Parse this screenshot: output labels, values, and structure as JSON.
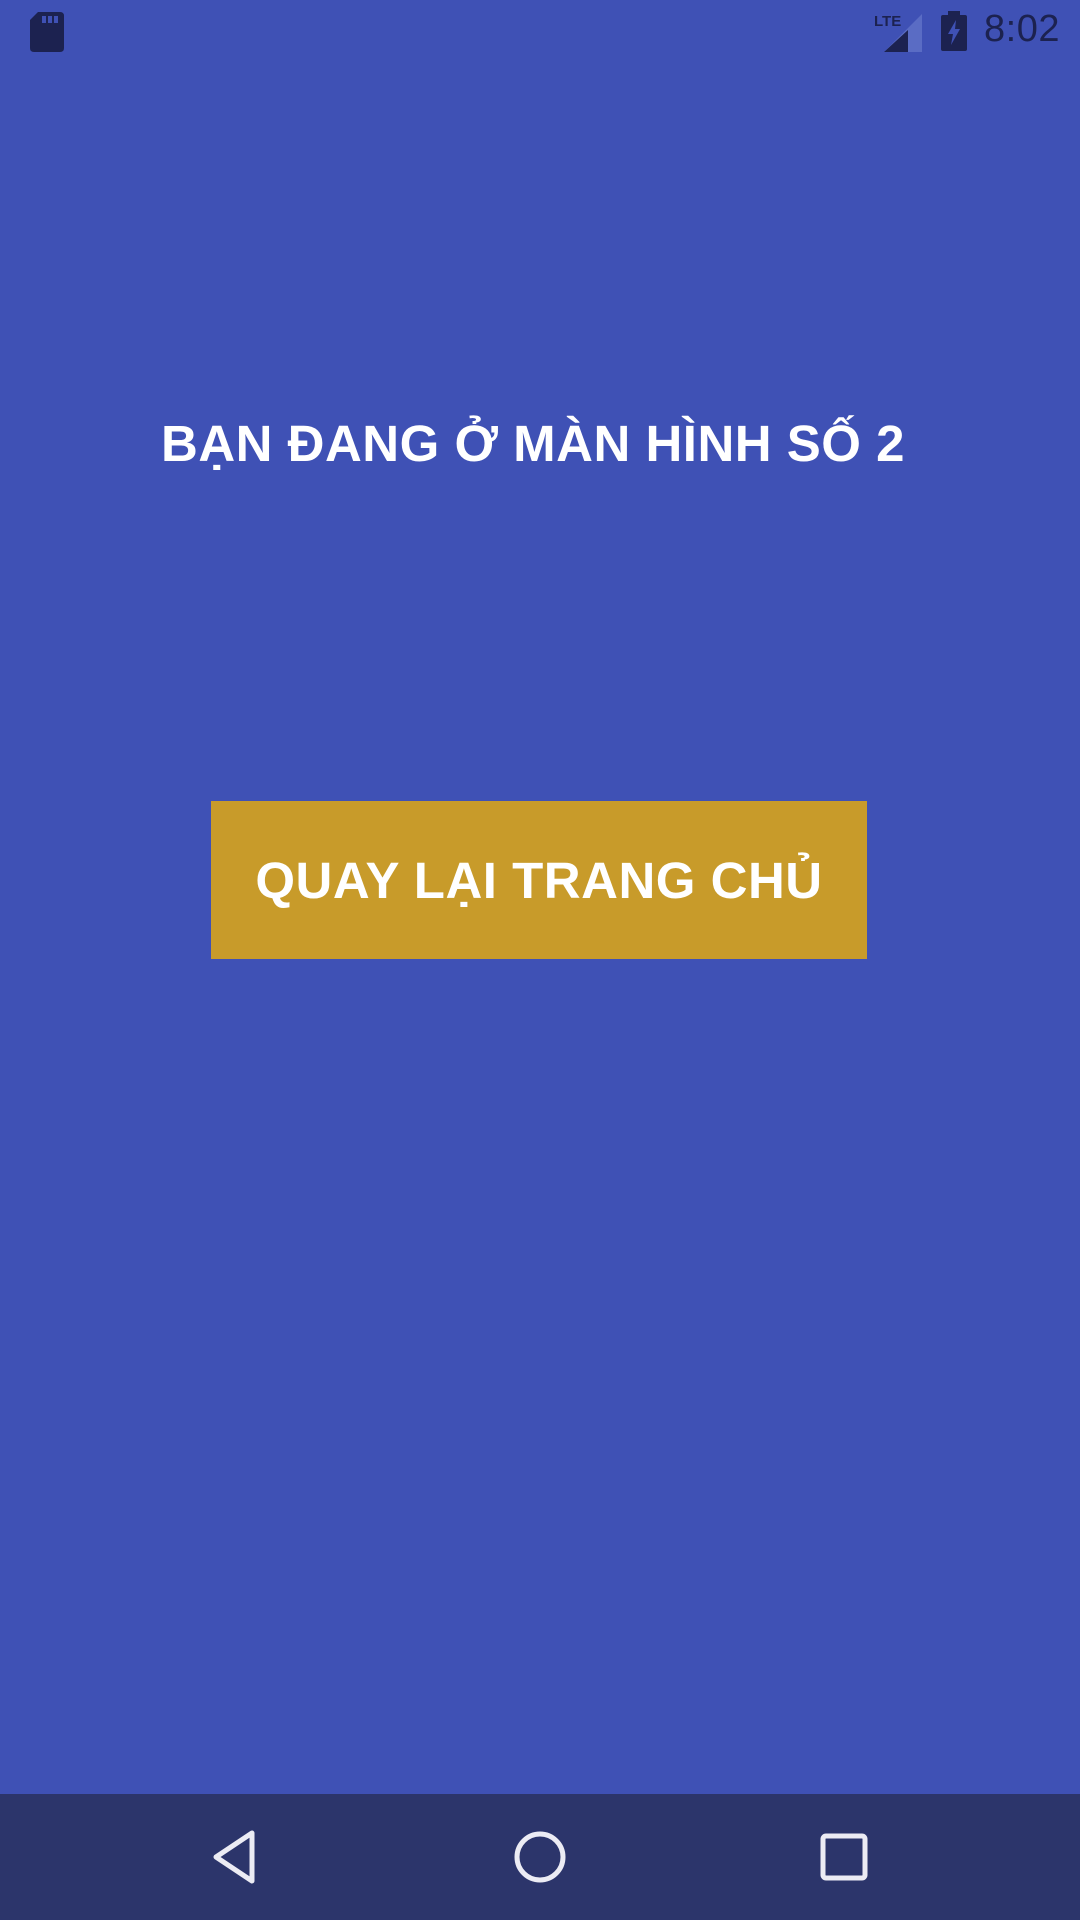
{
  "status_bar": {
    "time": "8:02",
    "network_label": "LTE",
    "icons": [
      "sd-card-icon",
      "lte-signal-icon",
      "battery-charging-icon"
    ]
  },
  "main": {
    "title": "BẠN ĐANG Ở MÀN HÌNH SỐ 2",
    "home_button_label": "QUAY LẠI TRANG CHỦ"
  },
  "nav_bar": {
    "icons": [
      "back-icon",
      "home-icon",
      "recents-icon"
    ]
  },
  "colors": {
    "background": "#3f51b5",
    "button": "#c89b2a",
    "nav_bar": "#2c356b",
    "status_icons": "#1c2250",
    "text": "#ffffff"
  }
}
